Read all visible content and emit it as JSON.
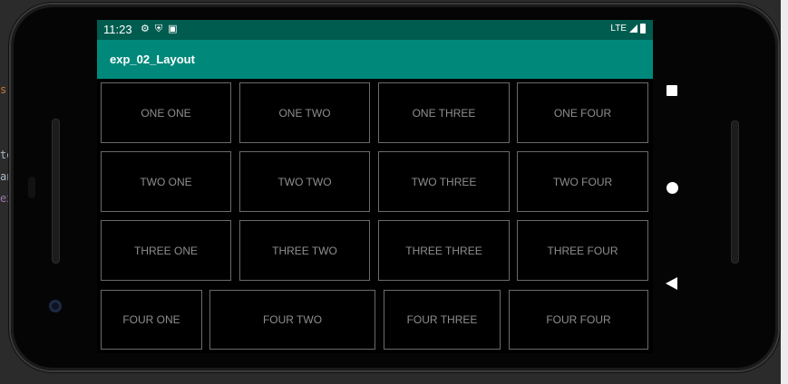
{
  "ide": {
    "fragments": [
      "s",
      "te",
      "an",
      "ex"
    ]
  },
  "status_bar": {
    "time": "11:23",
    "icons": [
      "gear-icon",
      "shield-icon",
      "a-icon"
    ],
    "network": "LTE"
  },
  "app_bar": {
    "title": "exp_02_Layout"
  },
  "grid": {
    "row1": [
      "ONE ONE",
      "ONE TWO",
      "ONE THREE",
      "ONE FOUR"
    ],
    "row2": [
      "TWO ONE",
      "TWO TWO",
      "TWO THREE",
      "TWO FOUR"
    ],
    "row3": [
      "THREE ONE",
      "THREE TWO",
      "THREE THREE",
      "THREE FOUR"
    ],
    "row4": [
      "FOUR ONE",
      "FOUR TWO",
      "FOUR THREE",
      "FOUR FOUR"
    ]
  },
  "nav": {
    "icons": [
      "recents-icon",
      "home-icon",
      "back-icon"
    ]
  },
  "colors": {
    "status_bar": "#005c4f",
    "app_bar": "#00897b",
    "cell_border": "#6b6b6b",
    "cell_text": "#8e8e8e"
  }
}
